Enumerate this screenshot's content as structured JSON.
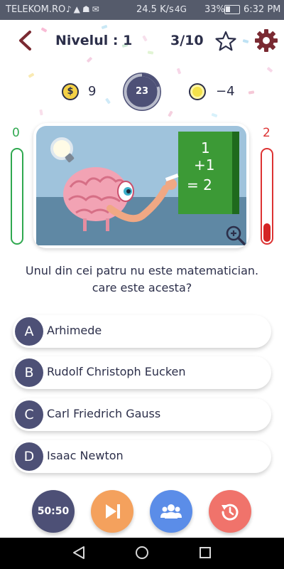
{
  "status_bar": {
    "carrier": "TELEKOM.RO",
    "speed": "24.5 K/s",
    "network": "4G",
    "battery": "33%",
    "time": "6:32 PM"
  },
  "header": {
    "level_label": "Nivelul : 1",
    "progress": "3/10"
  },
  "score": {
    "coin_symbol": "$",
    "coins": "9",
    "timer": "23",
    "bonus": "−4"
  },
  "meters": {
    "correct": "0",
    "wrong": "2",
    "correct_level": 0,
    "wrong_level": 0.2
  },
  "question": {
    "text": "Unul din cei patru nu este matematician. care este acesta?"
  },
  "answers": [
    {
      "letter": "A",
      "text": "Arhimede"
    },
    {
      "letter": "B",
      "text": "Rudolf Christoph Eucken"
    },
    {
      "letter": "C",
      "text": "Carl Friedrich Gauss"
    },
    {
      "letter": "D",
      "text": "Isaac Newton"
    }
  ],
  "lifelines": {
    "fifty_fifty": "50:50"
  },
  "chalkboard": {
    "line1": "1",
    "line2": "+1",
    "line3": "= 2"
  },
  "colors": {
    "accent": "#4d5076",
    "correct": "#2fa84f",
    "wrong": "#d33",
    "skip": "#f4a15d",
    "audience": "#5b8de8",
    "restart": "#f0736b"
  }
}
